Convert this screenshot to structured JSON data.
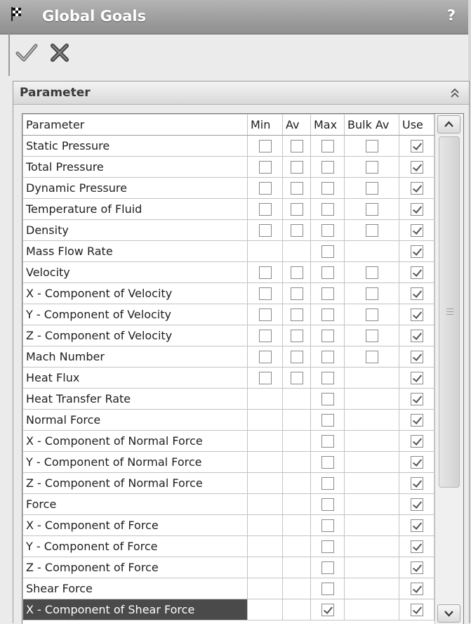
{
  "panel": {
    "title": "Global Goals",
    "help_label": "?",
    "title_icon": "checkered-flag-icon",
    "ok_icon": "checkmark-icon",
    "cancel_icon": "x-icon"
  },
  "group": {
    "title": "Parameter",
    "collapse_icon": "double-chevron-up-icon"
  },
  "table": {
    "columns": [
      "Parameter",
      "Min",
      "Av",
      "Max",
      "Bulk Av",
      "Use"
    ],
    "rows": [
      {
        "label": "Static Pressure",
        "min": false,
        "av": false,
        "max": false,
        "bulk": false,
        "use": true
      },
      {
        "label": "Total Pressure",
        "min": false,
        "av": false,
        "max": false,
        "bulk": false,
        "use": true
      },
      {
        "label": "Dynamic Pressure",
        "min": false,
        "av": false,
        "max": false,
        "bulk": false,
        "use": true
      },
      {
        "label": "Temperature of Fluid",
        "min": false,
        "av": false,
        "max": false,
        "bulk": false,
        "use": true
      },
      {
        "label": "Density",
        "min": false,
        "av": false,
        "max": false,
        "bulk": false,
        "use": true
      },
      {
        "label": "Mass Flow Rate",
        "min": null,
        "av": null,
        "max": false,
        "bulk": null,
        "use": true
      },
      {
        "label": "Velocity",
        "min": false,
        "av": false,
        "max": false,
        "bulk": false,
        "use": true
      },
      {
        "label": "X - Component of Velocity",
        "min": false,
        "av": false,
        "max": false,
        "bulk": false,
        "use": true
      },
      {
        "label": "Y - Component of Velocity",
        "min": false,
        "av": false,
        "max": false,
        "bulk": false,
        "use": true
      },
      {
        "label": "Z - Component of Velocity",
        "min": false,
        "av": false,
        "max": false,
        "bulk": false,
        "use": true
      },
      {
        "label": "Mach Number",
        "min": false,
        "av": false,
        "max": false,
        "bulk": false,
        "use": true
      },
      {
        "label": "Heat Flux",
        "min": false,
        "av": false,
        "max": false,
        "bulk": null,
        "use": true
      },
      {
        "label": "Heat Transfer Rate",
        "min": null,
        "av": null,
        "max": false,
        "bulk": null,
        "use": true
      },
      {
        "label": "Normal Force",
        "min": null,
        "av": null,
        "max": false,
        "bulk": null,
        "use": true
      },
      {
        "label": "X - Component of Normal Force",
        "min": null,
        "av": null,
        "max": false,
        "bulk": null,
        "use": true
      },
      {
        "label": "Y - Component of Normal Force",
        "min": null,
        "av": null,
        "max": false,
        "bulk": null,
        "use": true
      },
      {
        "label": "Z - Component of Normal Force",
        "min": null,
        "av": null,
        "max": false,
        "bulk": null,
        "use": true
      },
      {
        "label": "Force",
        "min": null,
        "av": null,
        "max": false,
        "bulk": null,
        "use": true
      },
      {
        "label": "X - Component of Force",
        "min": null,
        "av": null,
        "max": false,
        "bulk": null,
        "use": true
      },
      {
        "label": "Y - Component of Force",
        "min": null,
        "av": null,
        "max": false,
        "bulk": null,
        "use": true
      },
      {
        "label": "Z - Component of Force",
        "min": null,
        "av": null,
        "max": false,
        "bulk": null,
        "use": true
      },
      {
        "label": "Shear Force",
        "min": null,
        "av": null,
        "max": false,
        "bulk": null,
        "use": true
      },
      {
        "label": "X - Component of Shear Force",
        "min": null,
        "av": null,
        "max": true,
        "bulk": null,
        "use": true,
        "selected": true
      }
    ]
  },
  "colors": {
    "title_bar": "#a2a2a2",
    "selected_row": "#4a4a4a",
    "panel_bg": "#ebebeb"
  },
  "scrollbar": {
    "up_icon": "chevron-up-icon",
    "down_icon": "chevron-down-icon"
  }
}
